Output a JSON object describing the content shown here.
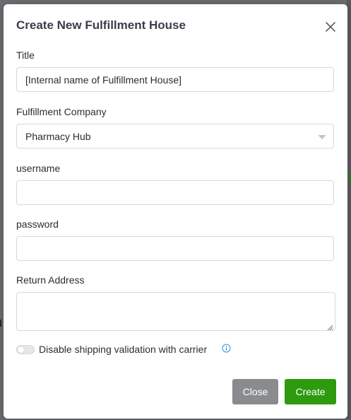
{
  "dialog": {
    "title": "Create New Fulfillment House",
    "close_icon": "close-icon"
  },
  "form": {
    "title": {
      "label": "Title",
      "value": "[Internal name of Fulfillment House]"
    },
    "fulfillment_company": {
      "label": "Fulfillment Company",
      "selected": "Pharmacy Hub"
    },
    "username": {
      "label": "username",
      "value": ""
    },
    "password": {
      "label": "password",
      "value": ""
    },
    "return_address": {
      "label": "Return Address",
      "value": ""
    },
    "disable_shipping_validation": {
      "label": "Disable shipping validation with carrier",
      "enabled": false,
      "info_icon": "info-icon"
    }
  },
  "footer": {
    "close_label": "Close",
    "create_label": "Create"
  },
  "colors": {
    "create_button": "#2e9a0e",
    "close_button": "#8a8b8f",
    "info_icon": "#2f8fe0"
  }
}
